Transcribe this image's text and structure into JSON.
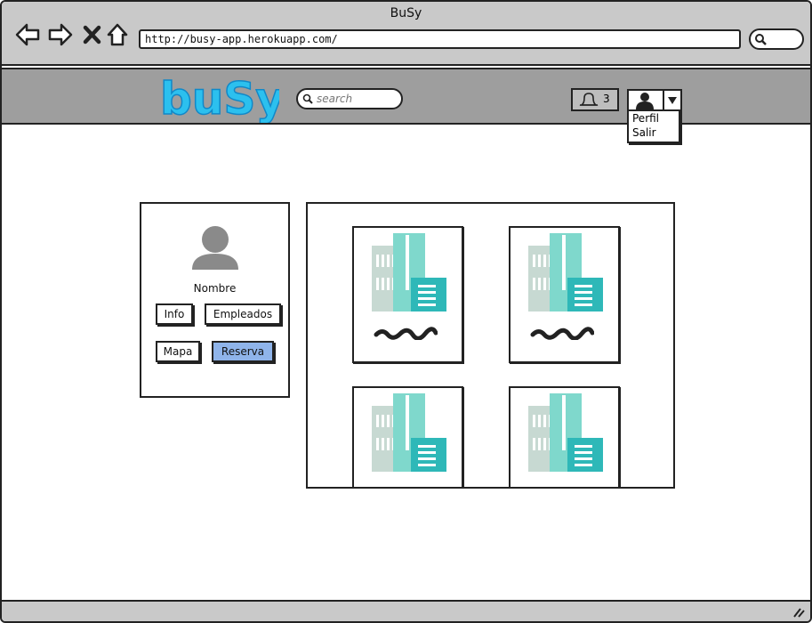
{
  "window": {
    "title": "BuSy"
  },
  "browser": {
    "url": "http://busy-app.herokuapp.com/"
  },
  "header": {
    "logo_text": "buSy",
    "search_placeholder": "search",
    "notification_count": "3",
    "user_menu": {
      "items": [
        "Perfil",
        "Salir"
      ]
    }
  },
  "profile": {
    "name": "Nombre",
    "buttons": {
      "info": "Info",
      "empleados": "Empleados",
      "mapa": "Mapa",
      "reserva": "Reserva"
    }
  },
  "colors": {
    "reserva_button": "#8fb4ea",
    "logo": "#2cc0ee",
    "building_teal": "#2eb8b8"
  },
  "icons": [
    "back-icon",
    "forward-icon",
    "close-icon",
    "home-icon",
    "search-icon",
    "bell-icon",
    "user-icon",
    "caret-down-icon",
    "building-icon",
    "resize-icon"
  ]
}
